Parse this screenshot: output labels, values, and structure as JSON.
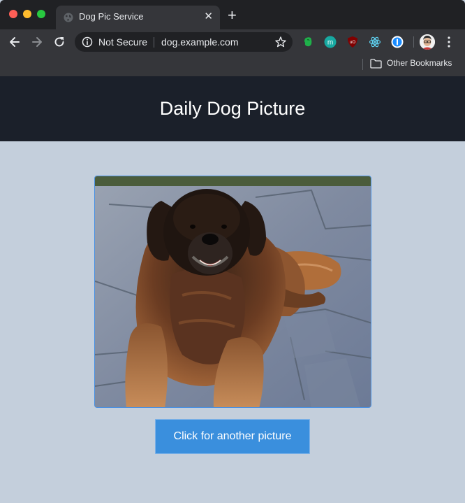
{
  "browser": {
    "tab": {
      "title": "Dog Pic Service"
    },
    "omnibox": {
      "security_label": "Not Secure",
      "url": "dog.example.com"
    },
    "bookmarks": {
      "other_label": "Other Bookmarks"
    },
    "extensions": [
      "evernote-icon",
      "m-extension-icon",
      "ublock-icon",
      "react-devtools-icon",
      "onepassword-icon"
    ]
  },
  "page": {
    "title": "Daily Dog Picture",
    "image": {
      "subject": "dog-photo",
      "alt_text": ""
    },
    "button_label": "Click for another picture"
  },
  "colors": {
    "header_bg": "#1b202a",
    "page_bg": "#c4cfdc",
    "button_bg": "#3a8fdd",
    "frame_border": "#4a90e2"
  }
}
